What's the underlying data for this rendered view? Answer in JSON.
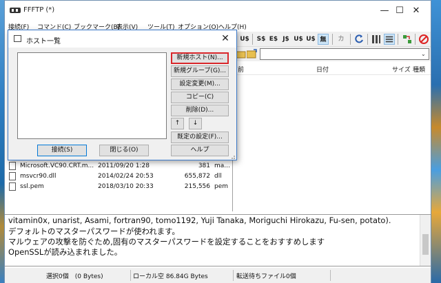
{
  "app": {
    "title": "FFFTP (*)"
  },
  "window_controls": {
    "minimize": "—",
    "maximize": "☐",
    "close": "✕"
  },
  "menu": [
    "接続(F)",
    "コマンド(C)",
    "ブックマーク(B)",
    "表示(V)",
    "ツール(T)",
    "オプション(O)",
    "ヘルプ(H)"
  ],
  "toolbar": {
    "buttons": [
      "U$",
      "S$",
      "E$",
      "J$",
      "U$",
      "U$",
      "無",
      "カ"
    ],
    "icons": [
      "refresh-icon",
      "list-view-icon",
      "detail-view-icon",
      "sync-icon",
      "stop-icon"
    ]
  },
  "remote_header": {
    "name": "前",
    "date": "日付",
    "size": "サイズ",
    "type": "種類"
  },
  "local_files": [
    {
      "name": "Microsoft.VC90.CRT.m...",
      "date": "2011/09/20  1:28",
      "size": "381",
      "type": "ma..."
    },
    {
      "name": "msvcr90.dll",
      "date": "2014/02/24 20:53",
      "size": "655,872",
      "type": "dll"
    },
    {
      "name": "ssl.pem",
      "date": "2018/03/10 20:33",
      "size": "215,556",
      "type": "pem"
    }
  ],
  "log": [
    "vitamin0x, unarist, Asami, fortran90, tomo1192, Yuji Tanaka, Moriguchi Hirokazu, Fu-sen, potato).",
    "デフォルトのマスターパスワードが使われます。",
    "マルウェアの攻撃を防ぐため,固有のマスターパスワードを設定することをおすすめします",
    "OpenSSLが読み込まれました。"
  ],
  "status": {
    "selected": "選択0個　(0 Bytes)",
    "local_free": "ローカル空 86.84G Bytes",
    "queue": "転送待ちファイル0個"
  },
  "dialog": {
    "title": "ホスト一覧",
    "close": "✕",
    "buttons": {
      "new_host": "新規ホスト(N)...",
      "new_group": "新規グループ(G)...",
      "edit": "設定変更(M)...",
      "copy": "コピー(C)",
      "delete": "削除(D)...",
      "up": "↑",
      "down": "↓",
      "default_settings": "既定の設定(F)...",
      "help": "ヘルプ",
      "connect": "接続(S)",
      "close_btn": "閉じる(O)"
    }
  }
}
